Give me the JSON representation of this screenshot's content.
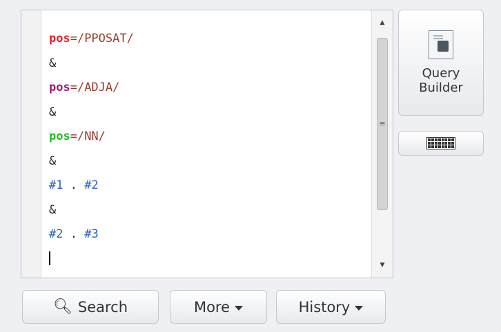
{
  "editor": {
    "lines": [
      {
        "kw": "pos",
        "rest": "=/PPOSAT/"
      },
      {
        "text": "&"
      },
      {
        "kw": "pos",
        "rest": "=/ADJA/"
      },
      {
        "text": "&"
      },
      {
        "kw": "pos",
        "rest": "=/NN/"
      },
      {
        "text": "&"
      },
      {
        "a": "#1",
        "op": " . ",
        "b": "#2"
      },
      {
        "text": "&"
      },
      {
        "a": "#2",
        "op": " . ",
        "b": "#3"
      }
    ]
  },
  "buttons": {
    "search": "Search",
    "more": "More",
    "history": "History",
    "query_builder_line1": "Query",
    "query_builder_line2": "Builder"
  },
  "icons": {
    "search": "search-icon",
    "keyboard": "keyboard-icon",
    "query_builder": "query-builder-icon"
  },
  "colors": {
    "kw1": "#e0212b",
    "kw2": "#a1197a",
    "kw3": "#27b827",
    "ref": "#2a60c0"
  }
}
